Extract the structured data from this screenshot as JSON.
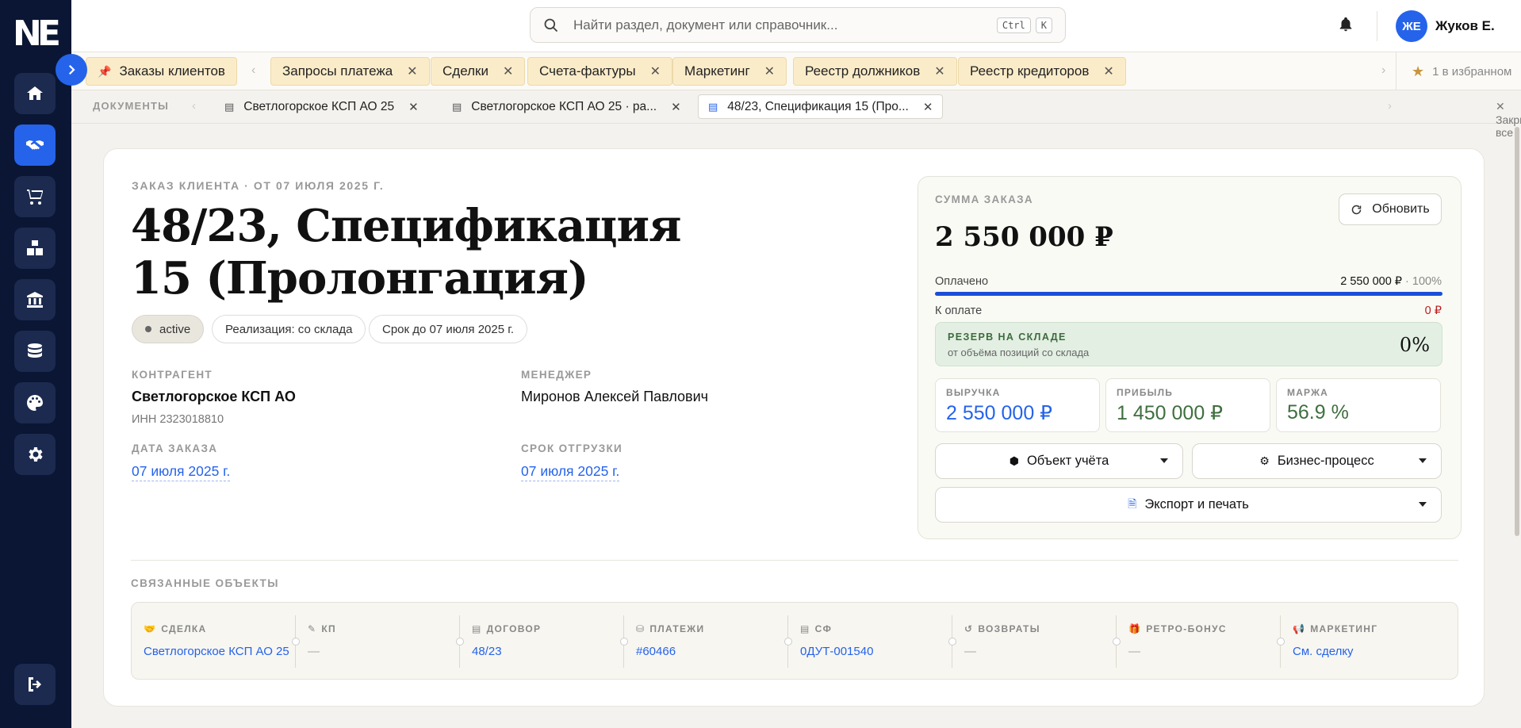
{
  "app": {
    "logo_text": "NE"
  },
  "sidebar": {
    "items": [
      {
        "name": "home",
        "icon": "home-icon",
        "active": false
      },
      {
        "name": "sales",
        "icon": "handshake-icon",
        "active": true
      },
      {
        "name": "purchases",
        "icon": "cart-icon",
        "active": false
      },
      {
        "name": "warehouse",
        "icon": "boxes-icon",
        "active": false
      },
      {
        "name": "finance",
        "icon": "bank-icon",
        "active": false
      },
      {
        "name": "database",
        "icon": "database-icon",
        "active": false
      },
      {
        "name": "design",
        "icon": "palette-icon",
        "active": false
      },
      {
        "name": "settings",
        "icon": "gear-icon",
        "active": false
      }
    ]
  },
  "header": {
    "search_placeholder": "Найти раздел, документ или справочник...",
    "shortcut_ctrl": "Ctrl",
    "shortcut_k": "K",
    "user_initials": "ЖЕ",
    "user_name": "Жуков Е."
  },
  "tabs": {
    "pinned": "Заказы клиентов",
    "items": [
      "Запросы платежа",
      "Сделки",
      "Счета-фактуры",
      "Маркетинг",
      "Реестр должников",
      "Реестр кредиторов"
    ],
    "favorites": "1 в избранном"
  },
  "documents": {
    "label": "ДОКУМЕНТЫ",
    "items": [
      "Светлогорское КСП АО 25",
      "Светлогорское КСП АО 25 · ра...",
      "48/23, Спецификация 15 (Про..."
    ],
    "close_all": "Закрыть все"
  },
  "order": {
    "kicker": "ЗАКАЗ КЛИЕНТА · ОТ 07 ИЮЛЯ 2025 Г.",
    "title": "48/23, Спецификация 15 (Пролонгация)",
    "status": "active",
    "chip_realization": "Реализация: со склада",
    "chip_deadline": "Срок до 07 июля 2025 г.",
    "counterparty_label": "КОНТРАГЕНТ",
    "counterparty": "Светлогорское КСП АО",
    "inn": "ИНН 2323018810",
    "manager_label": "МЕНЕДЖЕР",
    "manager": "Миронов Алексей Павлович",
    "order_date_label": "ДАТА ЗАКАЗА",
    "order_date": "07 июля 2025 г.",
    "ship_label": "СРОК ОТГРУЗКИ",
    "ship_date": "07 июля 2025 г."
  },
  "summary": {
    "label": "СУММА ЗАКАЗА",
    "refresh": "Обновить",
    "amount": "2 550 000 ₽",
    "paid_label": "Оплачено",
    "paid_value": "2 550 000 ₽",
    "paid_pct": "· 100%",
    "paid_fraction": 1.0,
    "due_label": "К оплате",
    "due_value": "0 ₽",
    "reserve_title": "РЕЗЕРВ НА СКЛАДЕ",
    "reserve_sub": "от объёма позиций со склада",
    "reserve_pct": "0%",
    "revenue_label": "ВЫРУЧКА",
    "revenue": "2 550 000 ₽",
    "profit_label": "ПРИБЫЛЬ",
    "profit": "1 450 000 ₽",
    "margin_label": "МАРЖА",
    "margin": "56.9 %",
    "btn_object": "Объект учёта",
    "btn_process": "Бизнес-процесс",
    "btn_export": "Экспорт и печать",
    "colors": {
      "blue": "#2563eb",
      "green": "#3f6f3f",
      "red": "#b91c1c"
    }
  },
  "related": {
    "label": "СВЯЗАННЫЕ ОБЪЕКТЫ",
    "items": [
      {
        "label": "СДЕЛКА",
        "value": "Светлогорское КСП АО 25",
        "icon": "handshake-icon"
      },
      {
        "label": "КП",
        "value": "—",
        "icon": "document-edit-icon"
      },
      {
        "label": "ДОГОВОР",
        "value": "48/23",
        "icon": "document-icon"
      },
      {
        "label": "ПЛАТЕЖИ",
        "value": "#60466",
        "icon": "money-bag-icon"
      },
      {
        "label": "СФ",
        "value": "0ДУТ-001540",
        "icon": "invoice-icon"
      },
      {
        "label": "ВОЗВРАТЫ",
        "value": "—",
        "icon": "undo-icon"
      },
      {
        "label": "РЕТРО-БОНУС",
        "value": "—",
        "icon": "gift-icon"
      },
      {
        "label": "МАРКЕТИНГ",
        "value": "См. сделку",
        "icon": "megaphone-icon"
      }
    ]
  }
}
